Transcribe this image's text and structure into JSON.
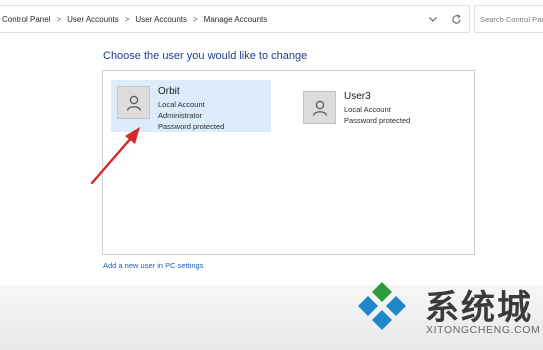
{
  "breadcrumb": {
    "items": [
      "Control Panel",
      "User Accounts",
      "User Accounts",
      "Manage Accounts"
    ]
  },
  "search": {
    "placeholder": "Search Control Panel"
  },
  "main": {
    "heading": "Choose the user you would like to change",
    "users": [
      {
        "name": "Orbit",
        "lines": [
          "Local Account",
          "Administrator",
          "Password protected"
        ],
        "selected": true
      },
      {
        "name": "User3",
        "lines": [
          "Local Account",
          "Password protected"
        ],
        "selected": false
      }
    ],
    "add_user_link": "Add a new user in PC settings"
  },
  "watermark": {
    "text": "系统城",
    "subtext": "XITONGCHENG.COM"
  },
  "icons": {
    "dropdown": "chevron-down-icon",
    "refresh": "refresh-icon",
    "avatar": "user-avatar-icon",
    "annotation": "red-arrow-annotation"
  },
  "colors": {
    "heading": "#1e3f8a",
    "link": "#1a5fb4",
    "selected_tile": "#dcecfb",
    "arrow": "#d42a2a"
  }
}
